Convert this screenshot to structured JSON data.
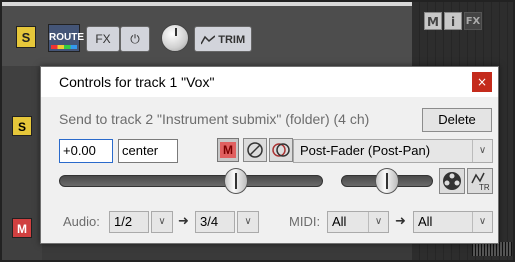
{
  "track_strip": {
    "solo_label": "S",
    "route_label": "ROUTE",
    "fx_label": "FX",
    "power_label": "⏻",
    "trim_label": "TRIM",
    "lower_solo_label": "S",
    "mute_label": "M"
  },
  "right_panel": {
    "buttons": [
      "M",
      "i",
      "FX"
    ]
  },
  "dialog": {
    "title": "Controls for track 1 \"Vox\"",
    "close_label": "×",
    "send_label": "Send to track 2 \"Instrument submix\" (folder) (4 ch)",
    "delete_label": "Delete",
    "volume_value": "+0.00",
    "pan_value": "center",
    "mute_label": "M",
    "mode_selected": "Post-Fader (Post-Pan)",
    "volume_fader_level": 0.67,
    "pan_fader_level": 0.5,
    "audio_label": "Audio:",
    "audio_src": "1/2",
    "audio_dst": "3/4",
    "midi_label": "MIDI:",
    "midi_src": "All",
    "midi_dst": "All",
    "arrow": "➜",
    "chevron": "∨"
  },
  "colors": {
    "solo_yellow": "#e6c73a",
    "mute_red": "#e06060",
    "close_red": "#c42b1c"
  }
}
